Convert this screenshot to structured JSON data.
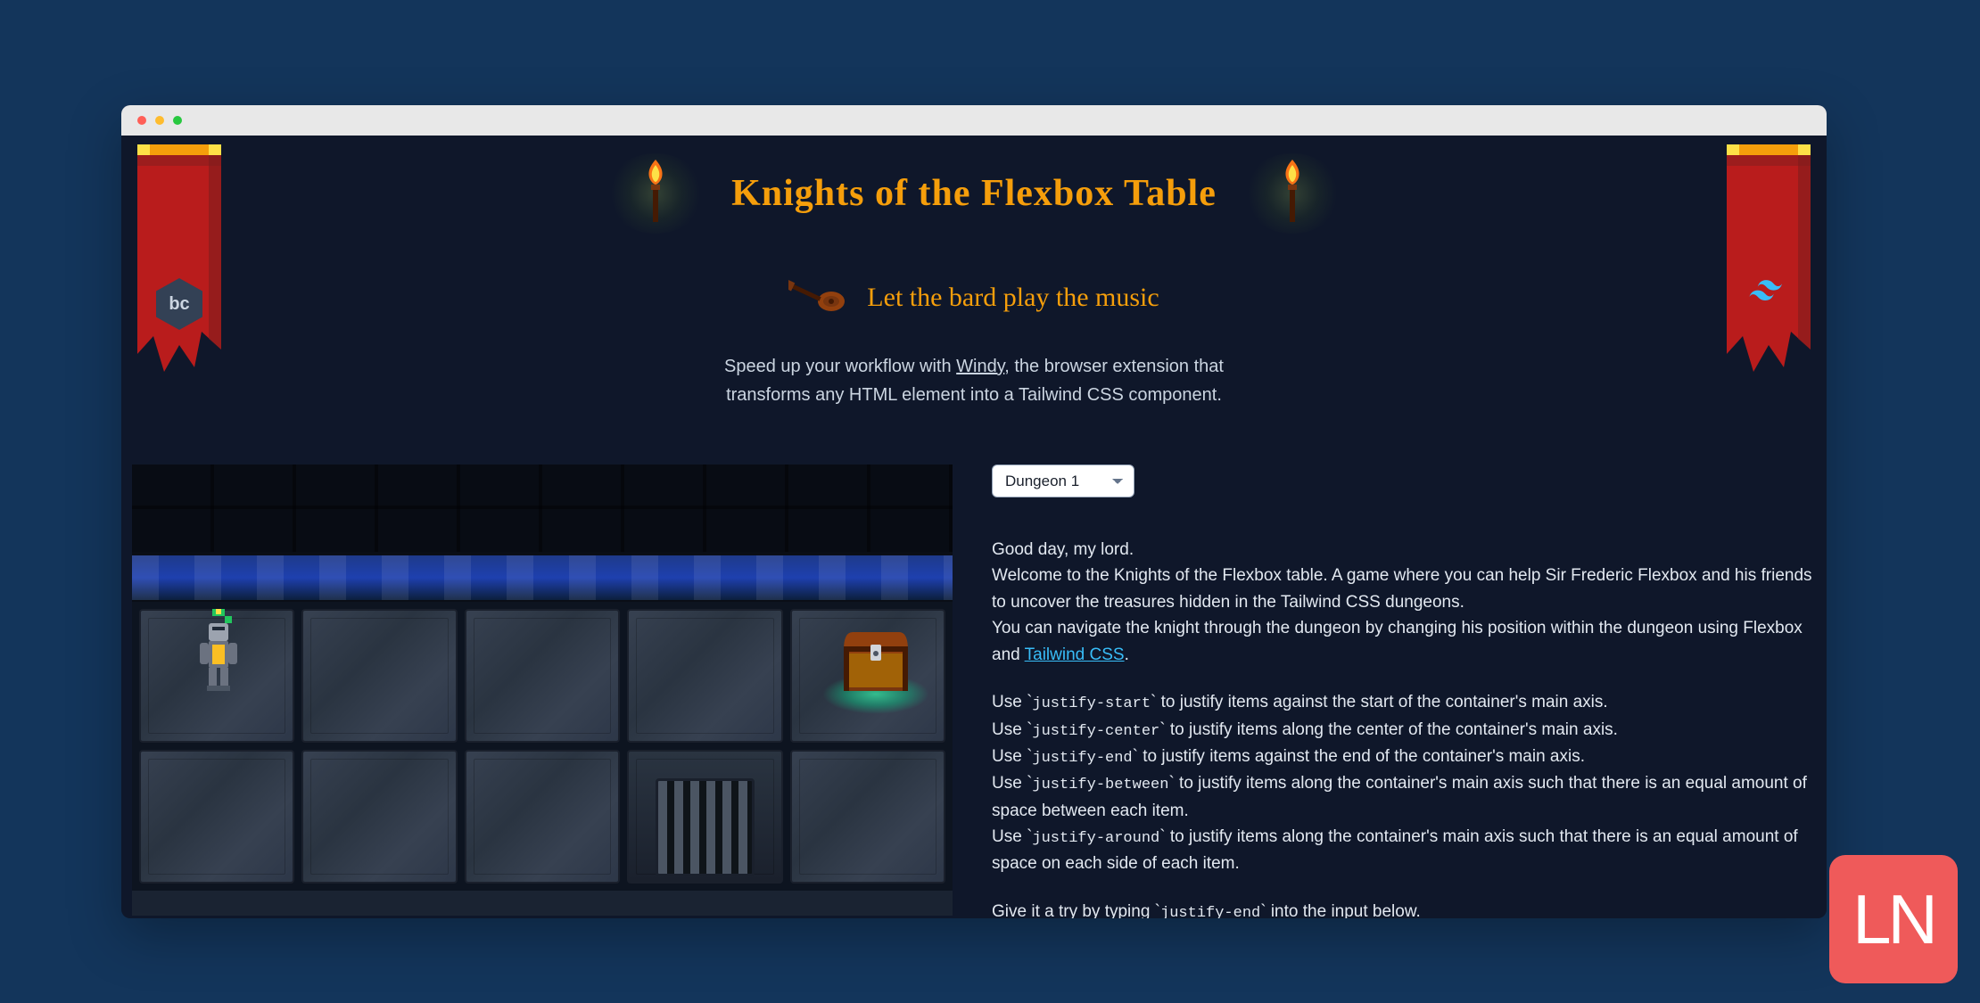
{
  "title": "Knights of the Flexbox Table",
  "bard_text": "Let the bard play the music",
  "promo": {
    "prefix": "Speed up your workflow with ",
    "link_text": "Windy",
    "suffix": ", the browser extension that transforms any HTML element into a Tailwind CSS component."
  },
  "level_select": {
    "selected": "Dungeon 1",
    "options": [
      "Dungeon 1"
    ]
  },
  "intro": {
    "greeting": "Good day, my lord.",
    "welcome": "Welcome to the Knights of the Flexbox table. A game where you can help Sir Frederic Flexbox and his friends to uncover the treasures hidden in the Tailwind CSS dungeons.",
    "nav_prefix": "You can navigate the knight through the dungeon by changing his position within the dungeon using Flexbox and ",
    "nav_link": "Tailwind CSS",
    "nav_suffix": "."
  },
  "instructions": [
    {
      "prefix": "Use `",
      "code": "justify-start",
      "suffix": "` to justify items against the start of the container's main axis."
    },
    {
      "prefix": "Use `",
      "code": "justify-center",
      "suffix": "` to justify items along the center of the container's main axis."
    },
    {
      "prefix": "Use `",
      "code": "justify-end",
      "suffix": "` to justify items against the end of the container's main axis."
    },
    {
      "prefix": "Use `",
      "code": "justify-between",
      "suffix": "` to justify items along the container's main axis such that there is an equal amount of space between each item."
    },
    {
      "prefix": "Use `",
      "code": "justify-around",
      "suffix": "` to justify items along the container's main axis such that there is an equal amount of space on each side of each item."
    }
  ],
  "try_it": {
    "prefix": "Give it a try by typing `",
    "code": "justify-end",
    "suffix": "` into the input below."
  },
  "icons": {
    "bc": "bc",
    "ln": "LN"
  }
}
